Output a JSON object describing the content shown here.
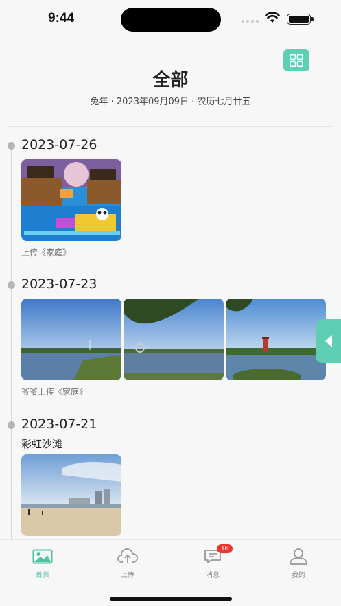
{
  "status": {
    "time": "9:44"
  },
  "header": {
    "title": "全部",
    "subtitle": "兔年 · 2023年09月09日 · 农历七月廿五",
    "grid_icon": "grid-icon"
  },
  "timeline": [
    {
      "date": "2023-07-26",
      "title": "",
      "caption": "上传《家庭》",
      "photos": [
        "game-screenshot"
      ]
    },
    {
      "date": "2023-07-23",
      "title": "",
      "caption": "爷爷上传《家庭》",
      "photos": [
        "lake-reeds",
        "lake-tree-sculpture",
        "lake-pagoda"
      ]
    },
    {
      "date": "2023-07-21",
      "title": "彩虹沙滩",
      "caption": "",
      "photos": [
        "beach-city"
      ]
    }
  ],
  "side_tab": {
    "icon": "triangle-left-icon"
  },
  "nav": {
    "items": [
      {
        "label": "首页",
        "icon": "image-icon",
        "active": true
      },
      {
        "label": "上传",
        "icon": "cloud-upload-icon",
        "active": false
      },
      {
        "label": "消息",
        "icon": "message-icon",
        "active": false,
        "badge": "16"
      },
      {
        "label": "我的",
        "icon": "user-icon",
        "active": false
      }
    ]
  },
  "colors": {
    "accent": "#5fcfb3",
    "badge": "#e8362f"
  }
}
